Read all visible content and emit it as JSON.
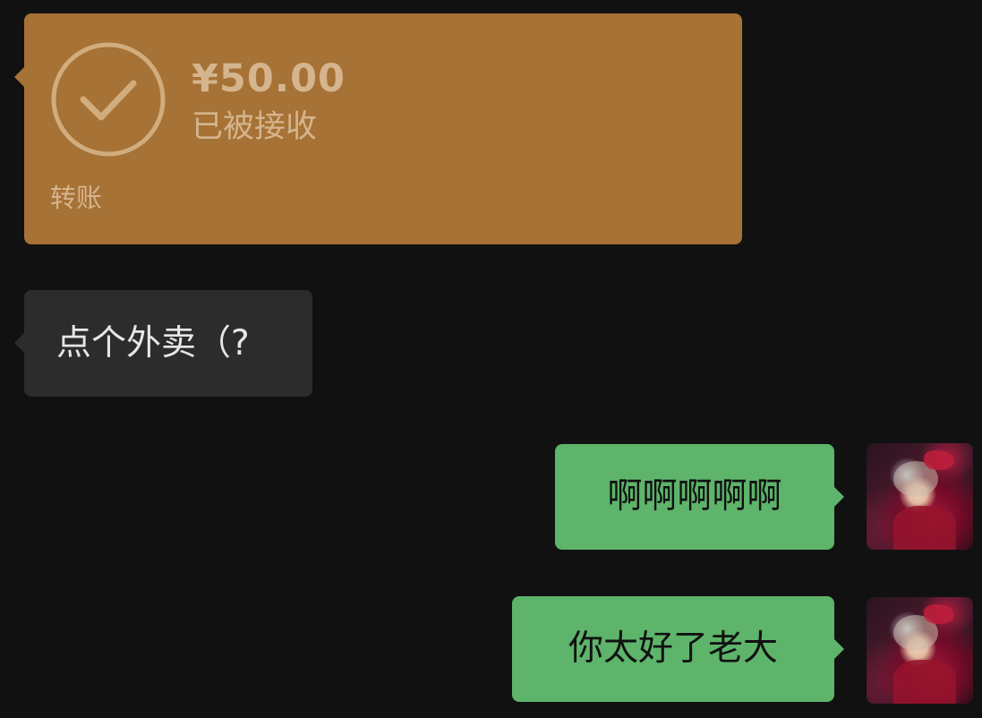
{
  "chat": {
    "transfer": {
      "amount": "¥50.00",
      "status": "已被接收",
      "label": "转账"
    },
    "messages": [
      {
        "direction": "incoming",
        "text": "点个外卖（?"
      },
      {
        "direction": "outgoing",
        "text": "啊啊啊啊啊"
      },
      {
        "direction": "outgoing",
        "text": "你太好了老大"
      }
    ]
  },
  "colors": {
    "background": "#111111",
    "transfer_card": "#A67236",
    "incoming_bubble": "#2C2C2C",
    "outgoing_bubble": "#5DB46A"
  },
  "icons": {
    "transfer_status": "check-circle-icon"
  }
}
